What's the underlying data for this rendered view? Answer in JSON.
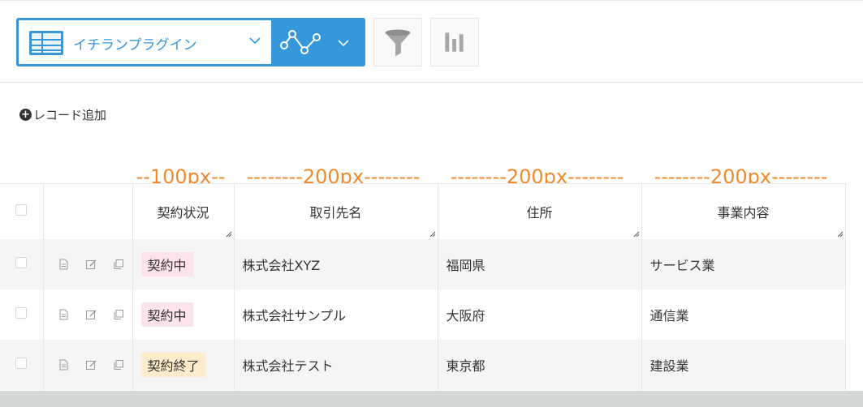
{
  "view": {
    "name": "イチランプラグイン"
  },
  "add_record_label": "レコード追加",
  "width_labels": [
    "--100px--",
    "--------200px--------",
    "--------200px--------",
    "--------200px--------"
  ],
  "columns": [
    "契約状況",
    "取引先名",
    "住所",
    "事業内容"
  ],
  "rows": [
    {
      "status": "契約中",
      "company": "株式会社XYZ",
      "address": "福岡県",
      "business": "サービス業"
    },
    {
      "status": "契約中",
      "company": "株式会社サンプル",
      "address": "大阪府",
      "business": "通信業"
    },
    {
      "status": "契約終了",
      "company": "株式会社テスト",
      "address": "東京都",
      "business": "建設業"
    }
  ],
  "colors": {
    "accent": "#3498db",
    "orange": "#f08a2b",
    "status_active_bg": "#fde3ea",
    "status_done_bg": "#ffeccc"
  }
}
